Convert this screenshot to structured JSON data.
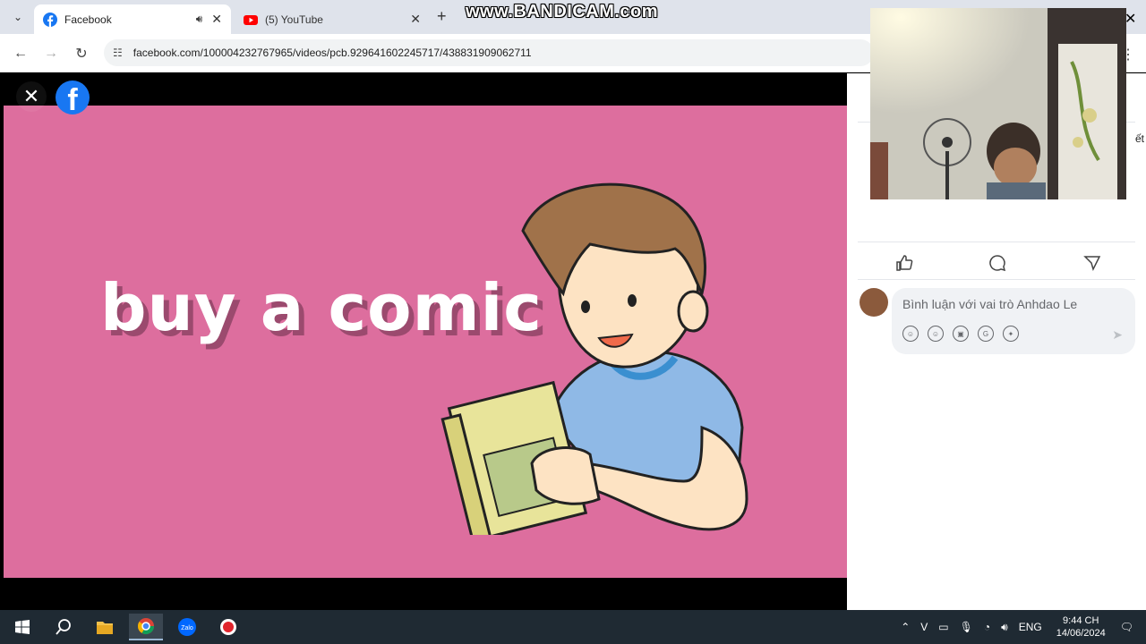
{
  "browser": {
    "tabs": [
      {
        "title": "Facebook",
        "active": true,
        "favicon": "facebook-icon",
        "audio": true
      },
      {
        "title": "(5) YouTube",
        "active": false,
        "favicon": "youtube-icon",
        "audio": false
      }
    ],
    "url": "facebook.com/100004232767965/videos/pcb.929641602245717/438831909062711"
  },
  "watermark": "www.BANDICAM.com",
  "video": {
    "caption": "buy a comic",
    "background_color": "#dd6e9e"
  },
  "comments": {
    "placeholder": "Bình luận với vai trò Anhdao Le",
    "partial_text": "ết"
  },
  "taskbar": {
    "language": "ENG",
    "time": "9:44 CH",
    "date": "14/06/2024"
  }
}
